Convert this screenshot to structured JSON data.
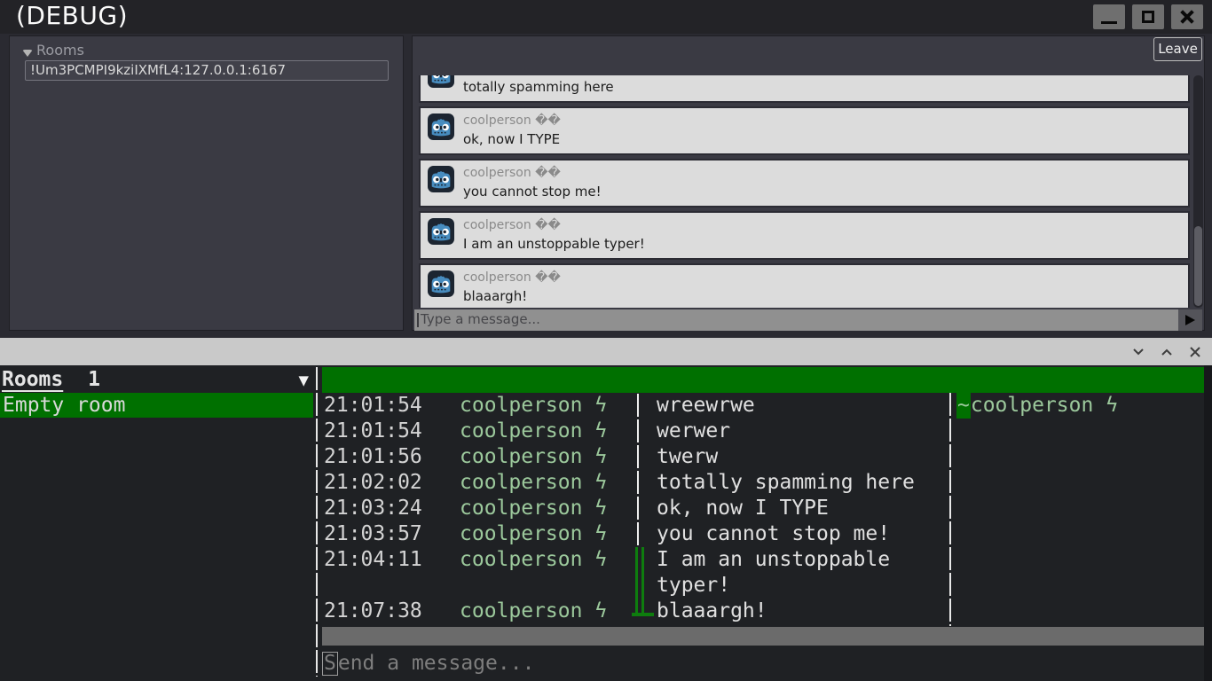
{
  "window": {
    "title": "(DEBUG)",
    "controls": [
      "minimize",
      "maximize",
      "close"
    ]
  },
  "rooms_panel": {
    "tree_label": "Rooms",
    "room_item": "!Um3PCMPI9kziIXMfL4:127.0.0.1:6167"
  },
  "chat": {
    "leave_button": "Leave",
    "messages": [
      {
        "author": "coolperson",
        "badge": "��",
        "text": "totally spamming here"
      },
      {
        "author": "coolperson",
        "badge": "��",
        "text": "ok, now I TYPE"
      },
      {
        "author": "coolperson",
        "badge": "��",
        "text": "you cannot stop me!"
      },
      {
        "author": "coolperson",
        "badge": "��",
        "text": "I am an unstoppable typer!"
      },
      {
        "author": "coolperson",
        "badge": "��",
        "text": "blaaargh!"
      }
    ],
    "input_placeholder": "Type a message..."
  },
  "panel_bar": {
    "icons": [
      "chevron-down",
      "chevron-up",
      "close"
    ]
  },
  "terminal": {
    "rooms_label": "Rooms",
    "rooms_count": "1",
    "rooms_caret": "▼",
    "room_selected": "Empty room",
    "bolt_glyph": "ϟ",
    "lines": [
      {
        "time": "21:01:54",
        "name": "coolperson",
        "text": "wreewrwe",
        "marker": "white"
      },
      {
        "time": "21:01:54",
        "name": "coolperson",
        "text": "werwer",
        "marker": "white"
      },
      {
        "time": "21:01:56",
        "name": "coolperson",
        "text": "twerw",
        "marker": "white"
      },
      {
        "time": "21:02:02",
        "name": "coolperson",
        "text": "totally spamming here",
        "marker": "white"
      },
      {
        "time": "21:03:24",
        "name": "coolperson",
        "text": "ok, now I TYPE",
        "marker": "white"
      },
      {
        "time": "21:03:57",
        "name": "coolperson",
        "text": "you cannot stop me!",
        "marker": "white"
      },
      {
        "time": "21:04:11",
        "name": "coolperson",
        "text": "I am an unstoppable",
        "marker": "green"
      },
      {
        "time": "",
        "name": "",
        "text": "typer!",
        "marker": "green"
      },
      {
        "time": "21:07:38",
        "name": "coolperson",
        "text": "blaaargh!",
        "marker": "green-end"
      }
    ],
    "member_prefix": "~",
    "member_name": "coolperson",
    "input_placeholder": "Send a message..."
  },
  "colors": {
    "accent_green_bg": "#007000",
    "accent_green_text": "#9cc99c",
    "marker_green": "#0e7d0e",
    "terminal_bg": "#1f2124",
    "card_bg": "#dcdcdc",
    "panel_bg": "#3a3a43",
    "bottom_bar_bg": "#c9c9c9"
  }
}
